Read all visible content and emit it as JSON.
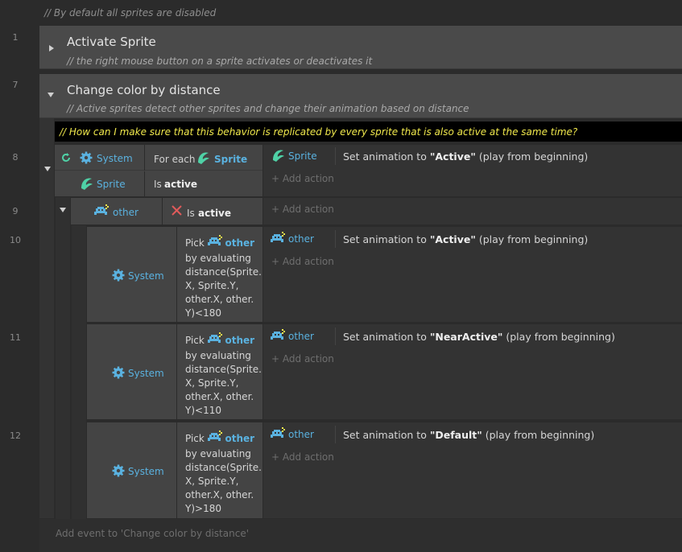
{
  "top_comment": "//  By default all sprites are disabled",
  "line_numbers": {
    "l1": "1",
    "l7": "7",
    "l8": "8",
    "l9": "9",
    "l10": "10",
    "l11": "11",
    "l12": "12"
  },
  "groups": [
    {
      "title": "Activate Sprite",
      "description": "//   the right mouse button on a sprite activates or deactivates it"
    },
    {
      "title": "Change color by distance",
      "description": "//   Active sprites detect other sprites and change their animation based on distance"
    }
  ],
  "banner_comment": "//   How can I make sure that this behavior is replicated by every sprite that is also active at the same time?",
  "event8": {
    "cond1": {
      "object": "System",
      "text": "For each",
      "target": "Sprite"
    },
    "cond2": {
      "object": "Sprite",
      "prefix": "Is",
      "value": "active"
    },
    "action": {
      "object": "Sprite",
      "pre": "Set animation to",
      "anim": "\"Active\"",
      "post": "(play from beginning)"
    },
    "add_action": "Add action"
  },
  "event9": {
    "cond": {
      "object": "other",
      "prefix": "Is",
      "value": "active"
    },
    "add_action": "Add action"
  },
  "sub_events": [
    {
      "object": "System",
      "pick": "Pick",
      "target": "other",
      "lines": [
        "by evaluating",
        "distance(Sprite.",
        "X, Sprite.Y,",
        "other.X, other.",
        "Y)<180"
      ],
      "action": {
        "object": "other",
        "pre": "Set animation to",
        "anim": "\"Active\"",
        "post": "(play from beginning)"
      }
    },
    {
      "object": "System",
      "pick": "Pick",
      "target": "other",
      "lines": [
        "by evaluating",
        "distance(Sprite.",
        "X, Sprite.Y,",
        "other.X, other.",
        "Y)<110"
      ],
      "action": {
        "object": "other",
        "pre": "Set animation to",
        "anim": "\"NearActive\"",
        "post": "(play from beginning)"
      }
    },
    {
      "object": "System",
      "pick": "Pick",
      "target": "other",
      "lines": [
        "by evaluating",
        "distance(Sprite.",
        "X, Sprite.Y,",
        "other.X, other.",
        "Y)>180"
      ],
      "action": {
        "object": "other",
        "pre": "Set animation to",
        "anim": "\"Default\"",
        "post": "(play from beginning)"
      }
    }
  ],
  "add_action_label": "Add action",
  "add_event": "Add event to 'Change color by distance'",
  "colors": {
    "object_blue": "#5ab2e0",
    "banner_text": "#f0e84c",
    "sprite_green": "#4fd1a6",
    "cross_red": "#e05a5a"
  },
  "icons": [
    "gear-icon",
    "sprite-icon",
    "other-icon",
    "loop-icon",
    "cross-icon",
    "plus-icon"
  ]
}
